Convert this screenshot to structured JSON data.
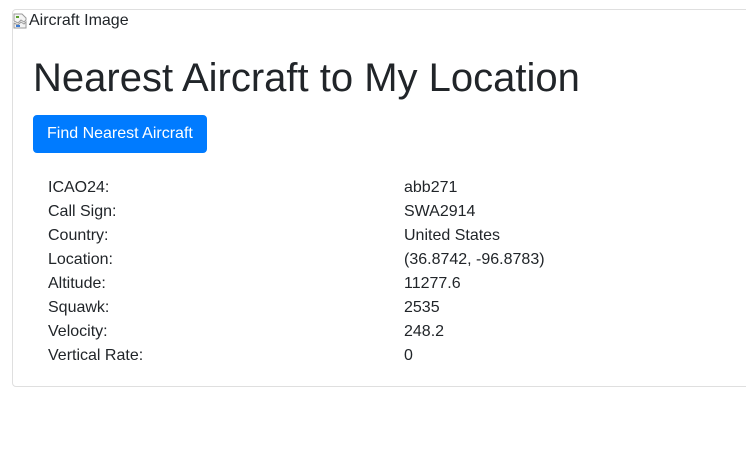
{
  "image": {
    "alt": "Aircraft Image",
    "icon": "broken-image-icon"
  },
  "page": {
    "title": "Nearest Aircraft to My Location"
  },
  "actions": {
    "find_button_label": "Find Nearest Aircraft",
    "button_color": "#007bff"
  },
  "aircraft": {
    "rows": [
      {
        "label": "ICAO24:",
        "value": "abb271"
      },
      {
        "label": "Call Sign:",
        "value": "SWA2914"
      },
      {
        "label": "Country:",
        "value": "United States"
      },
      {
        "label": "Location:",
        "value": "(36.8742, -96.8783)"
      },
      {
        "label": "Altitude:",
        "value": "11277.6"
      },
      {
        "label": "Squawk:",
        "value": "2535"
      },
      {
        "label": "Velocity:",
        "value": "248.2"
      },
      {
        "label": "Vertical Rate:",
        "value": "0"
      }
    ]
  }
}
